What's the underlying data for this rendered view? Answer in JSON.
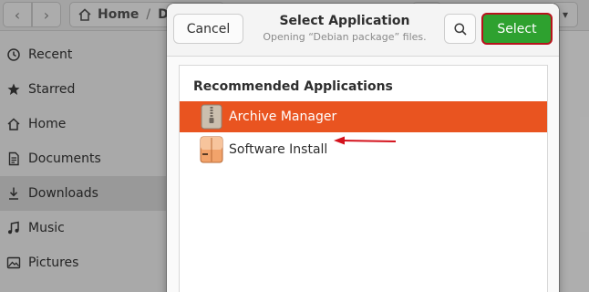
{
  "file_manager": {
    "path": {
      "home_label": "Home",
      "current_partial": "D"
    },
    "sidebar": {
      "items": [
        {
          "label": "Recent",
          "icon": "clock-icon"
        },
        {
          "label": "Starred",
          "icon": "star-icon"
        },
        {
          "label": "Home",
          "icon": "home-icon"
        },
        {
          "label": "Documents",
          "icon": "document-icon"
        },
        {
          "label": "Downloads",
          "icon": "download-icon",
          "active": true
        },
        {
          "label": "Music",
          "icon": "music-icon"
        },
        {
          "label": "Pictures",
          "icon": "picture-icon"
        }
      ]
    }
  },
  "dialog": {
    "title": "Select Application",
    "subtitle": "Opening “Debian package” files.",
    "cancel_label": "Cancel",
    "select_label": "Select",
    "search_icon": "search-icon",
    "section_heading": "Recommended Applications",
    "apps": [
      {
        "name": "Archive Manager",
        "icon": "archive-manager-icon",
        "selected": true
      },
      {
        "name": "Software Install",
        "icon": "software-install-icon",
        "selected": false
      }
    ]
  },
  "colors": {
    "selection": "#e95420",
    "select_button": "#2ea12f",
    "highlight_outline": "#b8121c",
    "annotation_arrow": "#d4121c"
  }
}
